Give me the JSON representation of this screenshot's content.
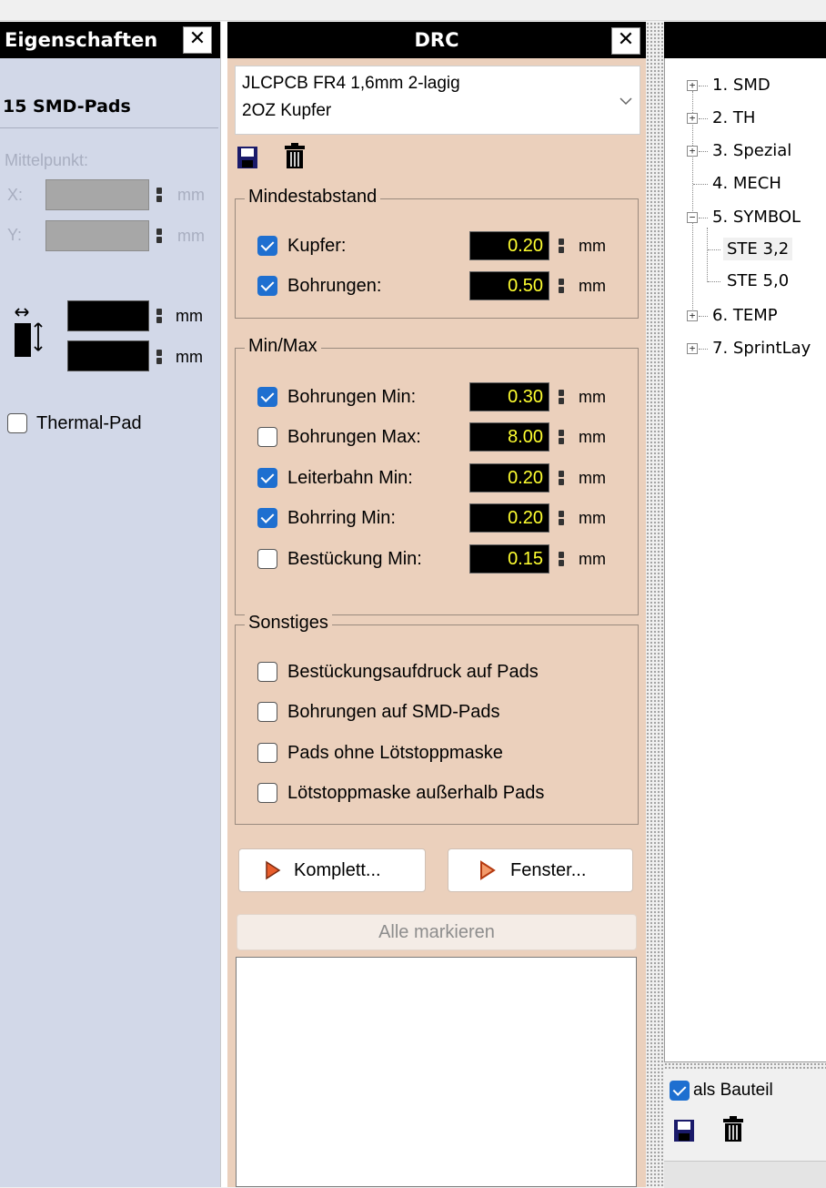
{
  "left_panel": {
    "title": "Eigenschaften",
    "close": "✕",
    "selection_title": "15 SMD-Pads",
    "center_label": "Mittelpunkt:",
    "x_label": "X:",
    "y_label": "Y:",
    "unit": "mm",
    "width_unit": "mm",
    "height_unit": "mm",
    "thermal_pad_label": "Thermal-Pad",
    "thermal_pad_checked": false
  },
  "drc": {
    "title": "DRC",
    "close": "✕",
    "preset_line1": "JLCPCB FR4 1,6mm 2-lagig",
    "preset_line2": "2OZ Kupfer",
    "min_clearance": {
      "legend": "Mindestabstand",
      "rows": [
        {
          "label": "Kupfer:",
          "checked": true,
          "value": "0.20",
          "unit": "mm"
        },
        {
          "label": "Bohrungen:",
          "checked": true,
          "value": "0.50",
          "unit": "mm"
        }
      ]
    },
    "minmax": {
      "legend": "Min/Max",
      "rows": [
        {
          "label": "Bohrungen Min:",
          "checked": true,
          "value": "0.30",
          "unit": "mm"
        },
        {
          "label": "Bohrungen Max:",
          "checked": false,
          "value": "8.00",
          "unit": "mm"
        },
        {
          "label": "Leiterbahn Min:",
          "checked": true,
          "value": "0.20",
          "unit": "mm"
        },
        {
          "label": "Bohrring Min:",
          "checked": true,
          "value": "0.20",
          "unit": "mm"
        },
        {
          "label": "Bestückung Min:",
          "checked": false,
          "value": "0.15",
          "unit": "mm"
        }
      ]
    },
    "misc": {
      "legend": "Sonstiges",
      "rows": [
        {
          "label": "Bestückungsaufdruck auf Pads",
          "checked": false
        },
        {
          "label": "Bohrungen auf SMD-Pads",
          "checked": false
        },
        {
          "label": "Pads ohne Lötstoppmaske",
          "checked": false
        },
        {
          "label": "Lötstoppmaske außerhalb Pads",
          "checked": false
        }
      ]
    },
    "complete_button": "Komplett...",
    "window_button": "Fenster...",
    "mark_all_button": "Alle markieren"
  },
  "tree": {
    "items": [
      {
        "label": "1. SMD"
      },
      {
        "label": "2. TH"
      },
      {
        "label": "3. Spezial"
      },
      {
        "label": "4. MECH"
      },
      {
        "label": "5. SYMBOL"
      },
      {
        "label": "STE 3,2"
      },
      {
        "label": "STE 5,0"
      },
      {
        "label": "6. TEMP"
      },
      {
        "label": "7. SprintLay"
      }
    ],
    "as_component_label": "als Bauteil",
    "as_component_checked": true
  },
  "colors": {
    "drc_bg": "#ebd0bc",
    "props_bg": "#d2d8e8",
    "value_fg": "#ffff30",
    "check_accent": "#1e6fd0"
  }
}
